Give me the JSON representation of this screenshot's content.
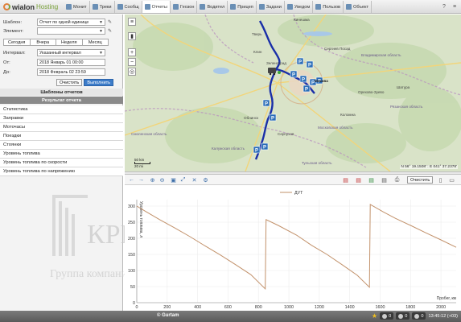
{
  "app": {
    "brand": "wialon",
    "brand_suffix": "Hosting"
  },
  "nav": {
    "tabs": [
      {
        "label": "Монит",
        "active": false
      },
      {
        "label": "Треки",
        "active": false
      },
      {
        "label": "Сообщ",
        "active": false
      },
      {
        "label": "Отчеты",
        "active": true
      },
      {
        "label": "Геозон",
        "active": false
      },
      {
        "label": "Водител",
        "active": false
      },
      {
        "label": "Прицеп",
        "active": false
      },
      {
        "label": "Задани",
        "active": false
      },
      {
        "label": "Уведом",
        "active": false
      },
      {
        "label": "Пользов",
        "active": false
      },
      {
        "label": "Объект",
        "active": false
      }
    ]
  },
  "form": {
    "template_label": "Шаблон:",
    "template_value": "Отчет по одной единице",
    "element_label": "Элемент:",
    "element_value": "",
    "periods": [
      "Сегодня",
      "Вчера",
      "Неделя",
      "Месяц"
    ],
    "interval_label": "Интервал:",
    "interval_value": "Указанный интервал",
    "from_label": "От:",
    "from_value": "2018 Январь 01 00:00",
    "to_label": "До:",
    "to_value": "2018 Февраль 02 23:59",
    "clear_label": "Очистить",
    "execute_label": "Выполнить"
  },
  "sections": {
    "templates": "Шаблоны отчетов",
    "result": "Результат отчета"
  },
  "report_items": [
    "Статистика",
    "Заправки",
    "Моточасы",
    "Поездки",
    "Стоянки",
    "Уровень топлива",
    "Уровень топлива по скорости",
    "Уровень топлива по напряжению"
  ],
  "watermark": {
    "mark": "КРК",
    "caption": "Группа компаний КРК"
  },
  "map": {
    "coordinates": "N 56° 19.1508' : E 041° 37.2378'",
    "scale_top": "50 km",
    "scale_bottom": "20 mi",
    "labels": [
      {
        "text": "Тверь"
      },
      {
        "text": "Клин"
      },
      {
        "text": "Сергиев Посад"
      },
      {
        "text": "Владимирская область"
      },
      {
        "text": "Москва"
      },
      {
        "text": "Московская область"
      },
      {
        "text": "Смоленская область"
      },
      {
        "text": "Калужская область"
      },
      {
        "text": "Тульская область"
      },
      {
        "text": "Рязанская область"
      },
      {
        "text": "Кинешма"
      },
      {
        "text": "Орехово-Зуево"
      },
      {
        "text": "Коломна"
      },
      {
        "text": "Серпухов"
      },
      {
        "text": "Обнинск"
      },
      {
        "text": "Зеленоград"
      },
      {
        "text": "Шатура"
      }
    ]
  },
  "chart_toolbar": {
    "clear_label": "Очистить"
  },
  "chart_data": {
    "type": "line",
    "series": [
      {
        "name": "ДУТ",
        "color": "#c2916a"
      }
    ],
    "legend_position": "top-center",
    "xlabel": "Пробег, км",
    "ylabel": "Уровень топлива, л",
    "xlim": [
      0,
      2100
    ],
    "ylim": [
      0,
      320
    ],
    "x_ticks": [
      0,
      200,
      400,
      600,
      800,
      1000,
      1200,
      1400,
      1600,
      1800,
      2000
    ],
    "y_ticks": [
      0,
      50,
      100,
      150,
      200,
      250,
      300
    ],
    "grid": true,
    "points": [
      [
        0,
        300
      ],
      [
        60,
        283
      ],
      [
        150,
        258
      ],
      [
        250,
        232
      ],
      [
        350,
        205
      ],
      [
        450,
        176
      ],
      [
        550,
        148
      ],
      [
        650,
        118
      ],
      [
        750,
        87
      ],
      [
        845,
        43
      ],
      [
        850,
        258
      ],
      [
        930,
        240
      ],
      [
        1050,
        210
      ],
      [
        1150,
        178
      ],
      [
        1250,
        150
      ],
      [
        1350,
        118
      ],
      [
        1450,
        85
      ],
      [
        1530,
        48
      ],
      [
        1535,
        305
      ],
      [
        1620,
        282
      ],
      [
        1700,
        262
      ],
      [
        1800,
        240
      ],
      [
        1900,
        217
      ],
      [
        2000,
        195
      ],
      [
        2100,
        172
      ]
    ]
  },
  "status": {
    "copyright": "© Gurtam",
    "badge_a": "0",
    "badge_b": "0",
    "badge_c": "0",
    "time": "13:45:12 (+03)"
  }
}
